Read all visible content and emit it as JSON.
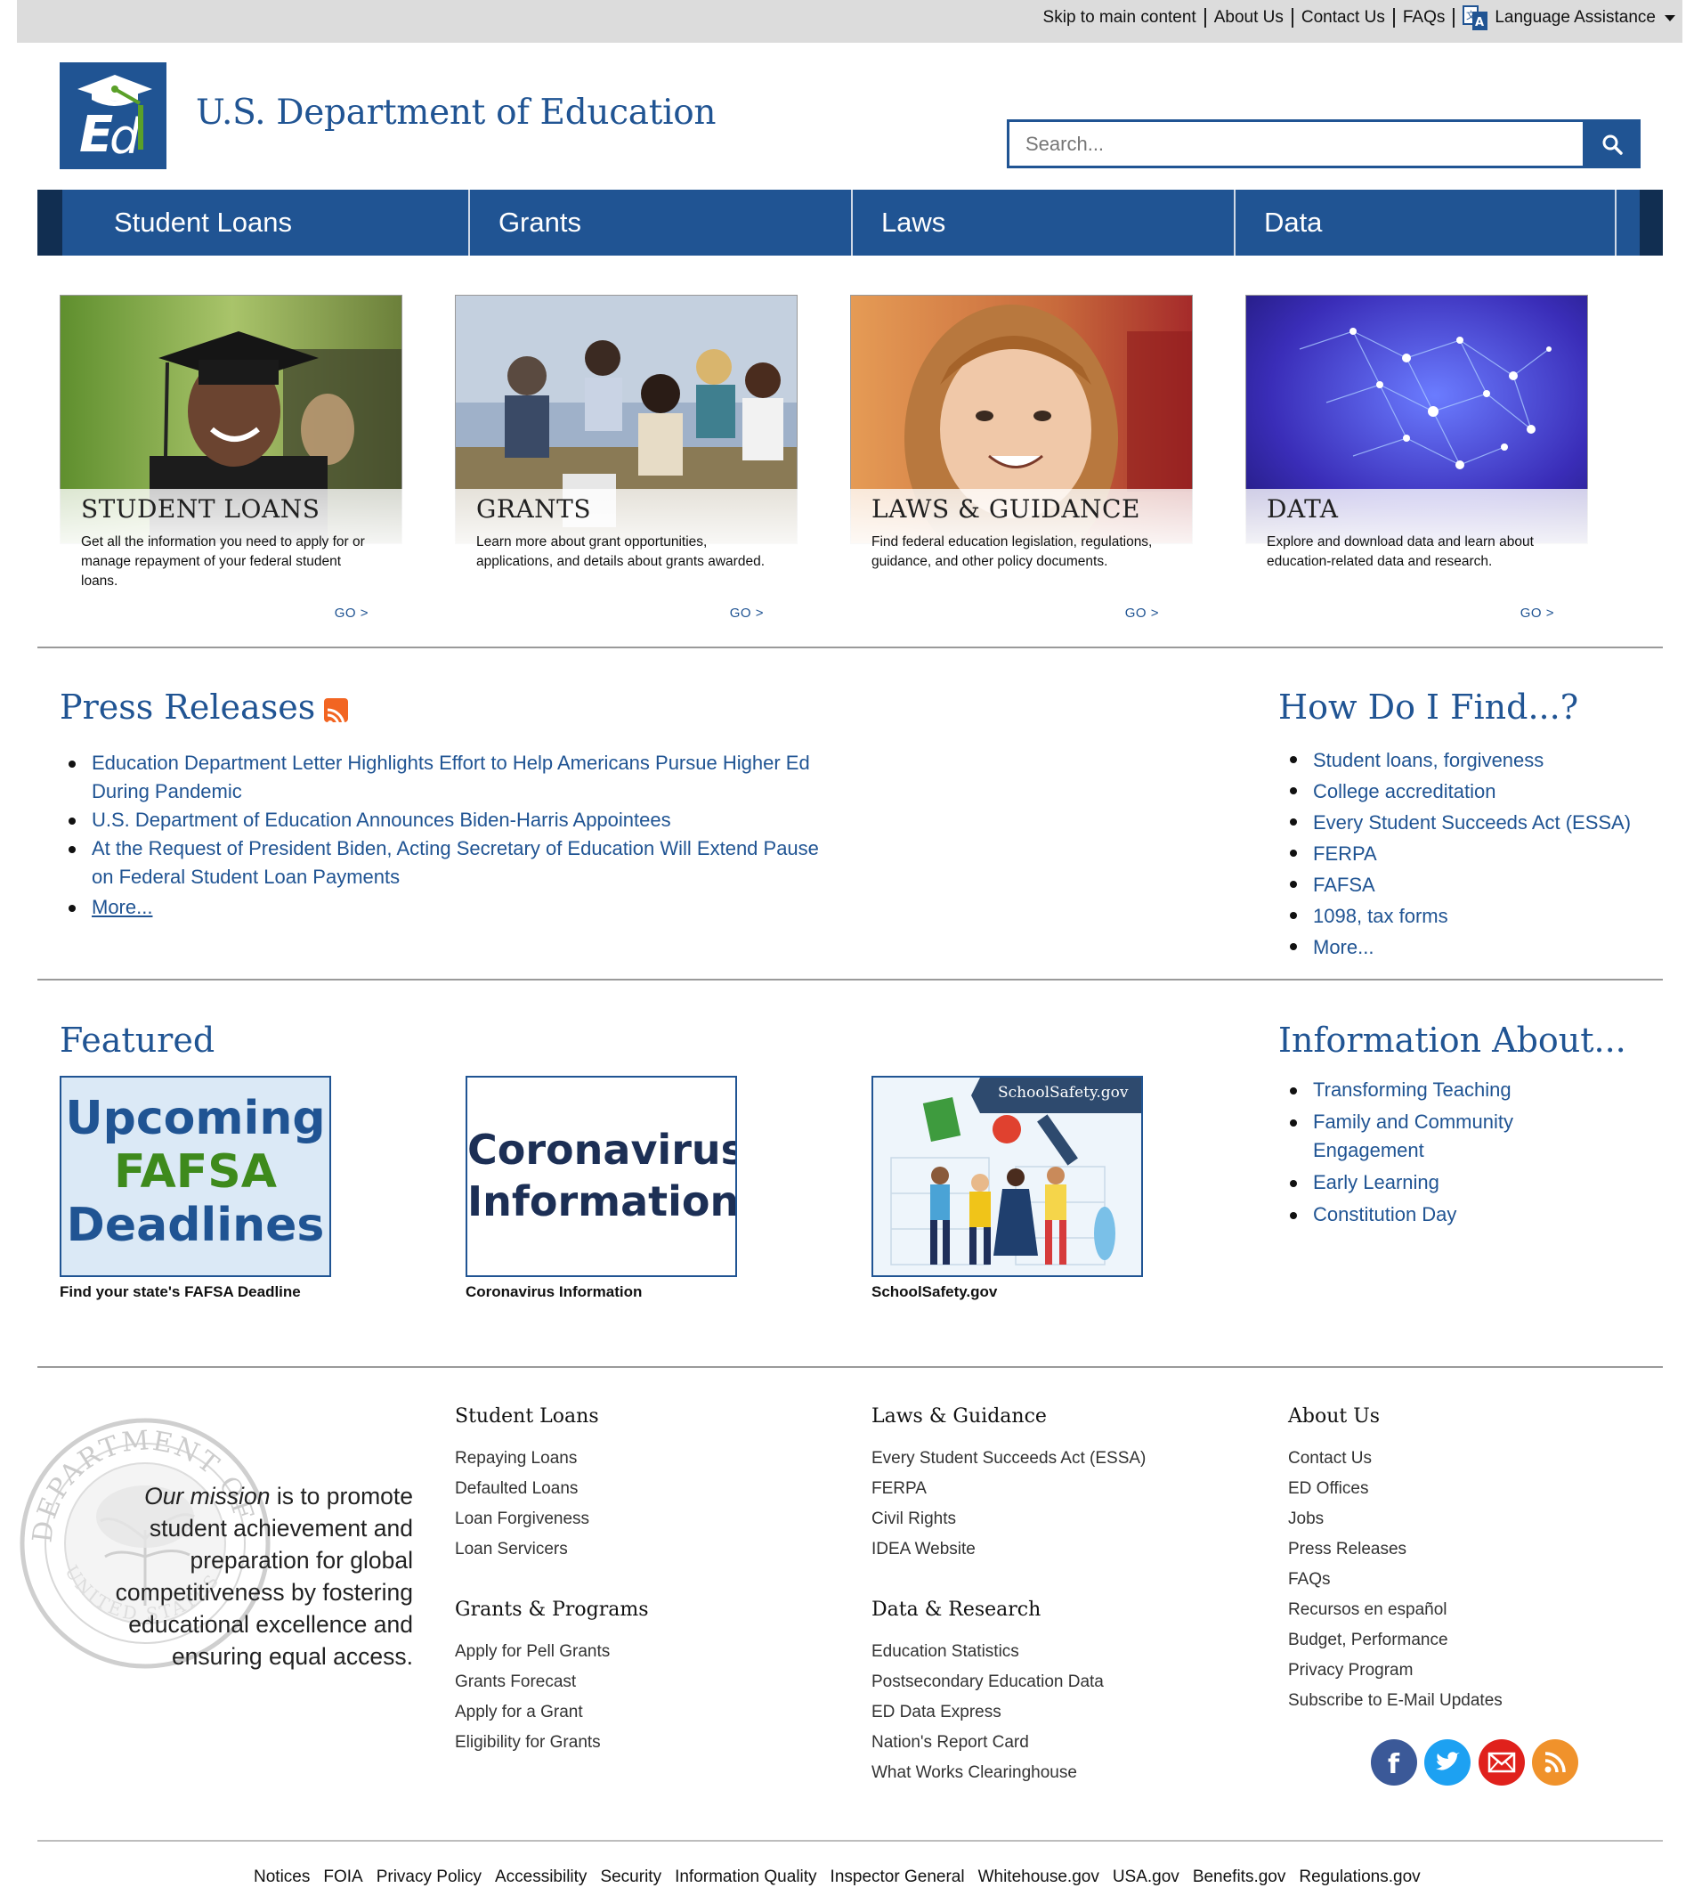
{
  "utility_bar": {
    "links": [
      "Skip to main content",
      "About Us",
      "Contact Us",
      "FAQs"
    ],
    "language": "Language Assistance"
  },
  "header": {
    "title": "U.S. Department of Education",
    "search_placeholder": "Search..."
  },
  "main_nav": [
    "Student Loans",
    "Grants",
    "Laws",
    "Data"
  ],
  "cards": [
    {
      "title": "STUDENT LOANS",
      "desc": "Get all the information you need to apply for or manage repayment of your federal student loans.",
      "go": "GO >"
    },
    {
      "title": "GRANTS",
      "desc": "Learn more about grant opportunities, applications, and details about grants awarded.",
      "go": "GO >"
    },
    {
      "title": "LAWS & GUIDANCE",
      "desc": "Find federal education legislation, regulations, guidance, and other policy documents.",
      "go": "GO >"
    },
    {
      "title": "DATA",
      "desc": "Explore and download data and learn about education-related data and research.",
      "go": "GO >"
    }
  ],
  "press": {
    "title": "Press Releases",
    "items": [
      "Education Department Letter Highlights Effort to Help Americans Pursue Higher Ed During Pandemic",
      "U.S. Department of Education Announces Biden-Harris Appointees",
      "At the Request of President Biden, Acting Secretary of Education Will Extend Pause on Federal Student Loan Payments",
      "More..."
    ]
  },
  "find": {
    "title": "How Do I Find...?",
    "items": [
      "Student loans, forgiveness",
      "College accreditation",
      "Every Student Succeeds Act (ESSA)",
      "FERPA",
      "FAFSA",
      "1098, tax forms",
      "More..."
    ]
  },
  "featured": {
    "title": "Featured",
    "tiles": [
      {
        "line1": "Upcoming",
        "line2": "FAFSA",
        "line3": "Deadlines",
        "caption": "Find your state's FAFSA Deadline"
      },
      {
        "line1": "Coronavirus",
        "line2": "Information",
        "caption": "Coronavirus Information"
      },
      {
        "banner": "SchoolSafety.gov",
        "caption": "SchoolSafety.gov"
      }
    ]
  },
  "info_about": {
    "title": "Information About...",
    "items": [
      "Transforming Teaching",
      "Family and Community Engagement",
      "Early Learning",
      "Constitution Day"
    ]
  },
  "footer": {
    "mission_em": "Our mission",
    "mission_rest": " is to promote student achievement and preparation for global competitiveness by fostering educational excellence and ensuring equal access.",
    "seal_text": "DEPARTMENT OF EDUCATION",
    "seal_bottom": "UNITED STATES",
    "columns": {
      "student_loans": {
        "title": "Student Loans",
        "items": [
          "Repaying Loans",
          "Defaulted Loans",
          "Loan Forgiveness",
          "Loan Servicers"
        ]
      },
      "grants": {
        "title": "Grants & Programs",
        "items": [
          "Apply for Pell Grants",
          "Grants Forecast",
          "Apply for a Grant",
          "Eligibility for Grants"
        ]
      },
      "laws": {
        "title": "Laws & Guidance",
        "items": [
          "Every Student Succeeds Act (ESSA)",
          "FERPA",
          "Civil Rights",
          "IDEA Website"
        ]
      },
      "data": {
        "title": "Data & Research",
        "items": [
          "Education Statistics",
          "Postsecondary Education Data",
          "ED Data Express",
          "Nation's Report Card",
          "What Works Clearinghouse"
        ]
      },
      "about": {
        "title": "About Us",
        "items": [
          "Contact Us",
          "ED Offices",
          "Jobs",
          "Press Releases",
          "FAQs",
          "Recursos en español",
          "Budget, Performance",
          "Privacy Program",
          "Subscribe to E-Mail Updates"
        ]
      }
    },
    "social_icons": [
      "facebook-icon",
      "twitter-icon",
      "email-icon",
      "rss-icon"
    ],
    "bottom_links": [
      "Notices",
      "FOIA",
      "Privacy Policy",
      "Accessibility",
      "Security",
      "Information Quality",
      "Inspector General",
      "Whitehouse.gov",
      "USA.gov",
      "Benefits.gov",
      "Regulations.gov"
    ]
  },
  "colors": {
    "primary": "#205493",
    "dark_navy": "#112e51",
    "facebook": "#3b5998",
    "twitter": "#1da1f2",
    "email": "#e0211c",
    "rss": "#f0922b"
  }
}
